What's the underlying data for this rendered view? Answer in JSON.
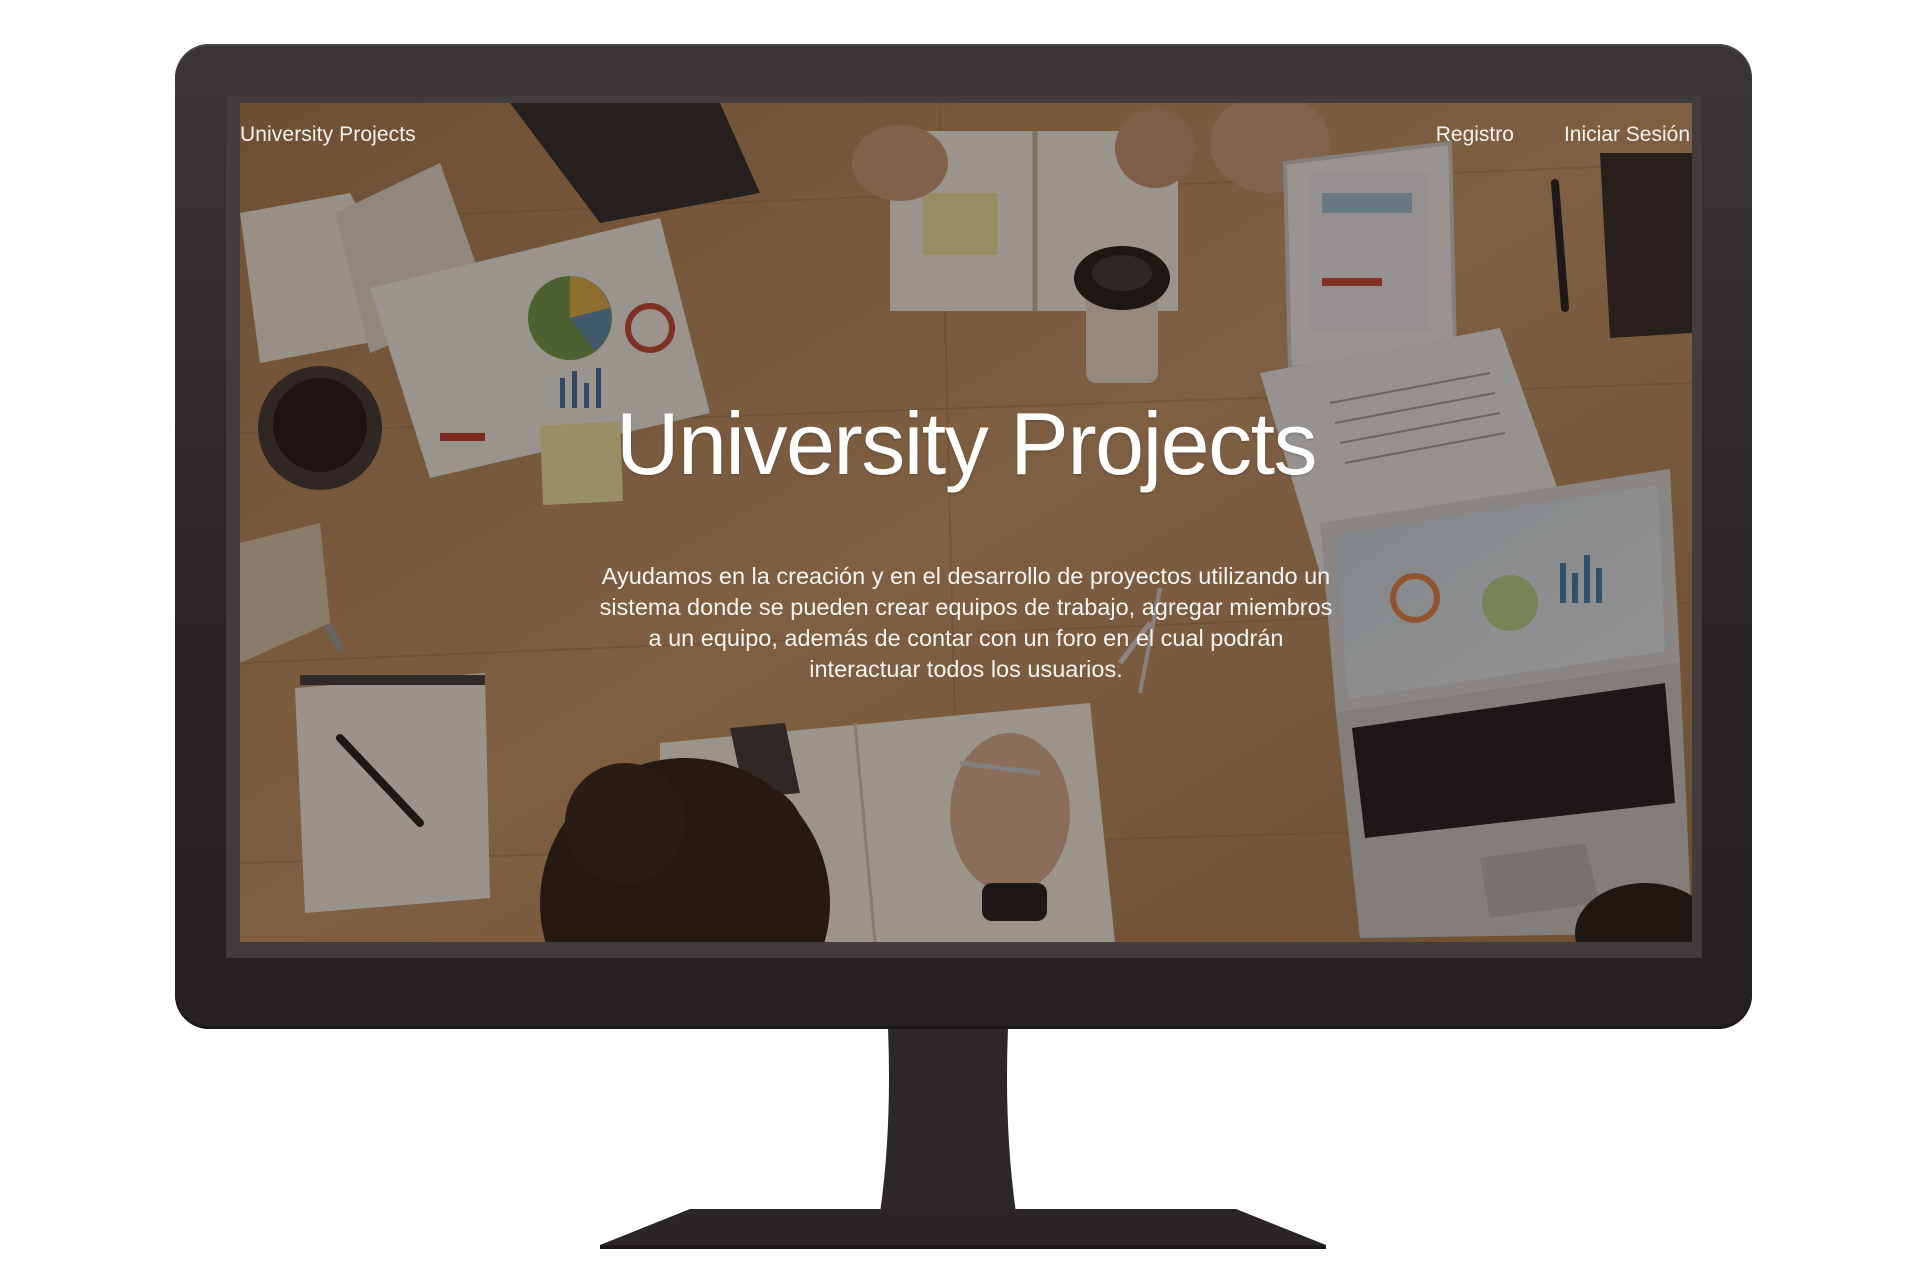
{
  "site": {
    "brand": "University Projects",
    "nav": {
      "register_label": "Registro",
      "login_label": "Iniciar Sesión"
    },
    "hero": {
      "title": "University Projects",
      "description": "Ayudamos en la creación y en el desarrollo de proyectos utilizando un sistema donde se pueden crear equipos de trabajo, agregar miembros a un equipo, además de contar con un foro en el cual podrán interactuar todos los usuarios."
    }
  },
  "colors": {
    "bezel": "#2b2728",
    "screen_frame": "#413d3e",
    "overlay": "rgba(30, 20, 12, 0.42)",
    "text": "#ffffff",
    "table_wood": "#b8875a"
  },
  "icons": {
    "monitor": "monitor-icon",
    "laptop": "laptop-icon",
    "coffee_cup": "coffee-cup-icon"
  }
}
